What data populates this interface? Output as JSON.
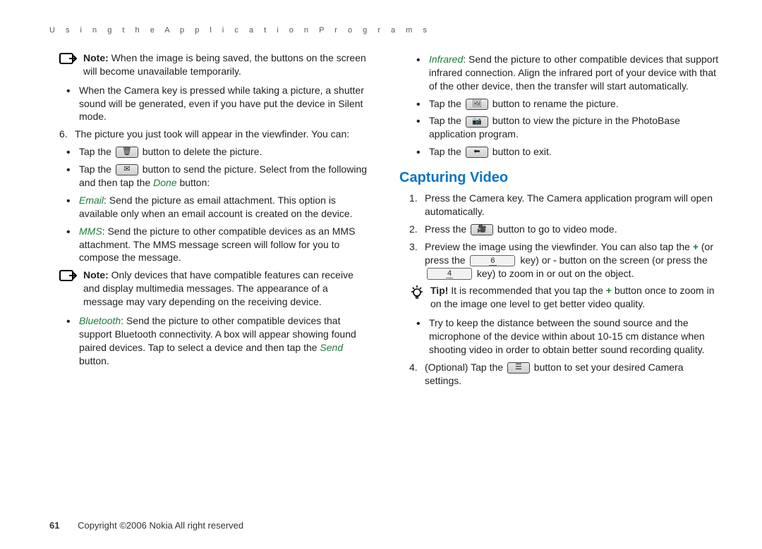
{
  "header": "U s i n g   t h e   A p p l i c a t i o n   P r o g r a m s",
  "left": {
    "note1_label": "Note:",
    "note1_body": " When the image is being saved, the buttons on the screen will become unavailable temporarily.",
    "bullet_silent": "When the Camera key is pressed while taking a picture, a shutter sound will be generated, even if you have put the device in Silent mode.",
    "step6_num": "6.",
    "step6": "The picture you just took will appear in the viewfinder. You can:",
    "b_delete_a": "Tap the ",
    "b_delete_b": " button to delete the picture.",
    "b_send_a": "Tap the ",
    "b_send_b": " button to send the picture. Select from the following and then tap the ",
    "b_send_done": "Done",
    "b_send_c": " button:",
    "email_label": "Email",
    "email_body": ": Send the picture as email attachment. This option is available only when an email account is created on the device.",
    "mms_label": "MMS",
    "mms_body": ": Send the picture to other compatible devices as an MMS attachment. The MMS message screen will follow for you to compose the message.",
    "note2_label": "Note:",
    "note2_body": " Only devices that have compatible features can receive and display multimedia messages. The appearance of a message may vary depending on the receiving device.",
    "bt_label": "Bluetooth",
    "bt_body": ": Send the picture to other compatible devices that support Bluetooth connectivity. A box will appear showing found paired devices. Tap to select a device and then tap the ",
    "bt_send": "Send",
    "bt_tail": " button.",
    "icons": {
      "trash": "🗑",
      "envelope": "✉"
    }
  },
  "right": {
    "ir_label": "Infrared",
    "ir_body": ": Send the picture to other compatible devices that support infrared connection. Align the infrared port of your device with that of the other device, then the transfer will start automatically.",
    "rename_a": "Tap the ",
    "rename_b": " button to rename the picture.",
    "view_a": "Tap the ",
    "view_b": " button to view the picture in the PhotoBase application program.",
    "exit_a": "Tap the ",
    "exit_b": " button to exit.",
    "h2": "Capturing Video",
    "s1_num": "1.",
    "s1": "Press the Camera key. The Camera application program will open automatically.",
    "s2_num": "2.",
    "s2_a": "Press the ",
    "s2_b": " button to go to video mode.",
    "s3_num": "3.",
    "s3_a": "Preview the image using the viewfinder. You can also tap the ",
    "s3_plus": "+",
    "s3_b": " (or press the ",
    "key6": "6",
    "s3_c": " key) or ",
    "s3_minus": "-",
    "s3_d": " button on the screen (or press the ",
    "key4": "4",
    "s3_e": " key) to zoom in or out on the object.",
    "tip_label": "Tip!",
    "tip_body": " It is recommended that you tap the ",
    "tip_plus": "+",
    "tip_tail": " button once to zoom in on the image one level to get better video quality.",
    "dist": "Try to keep the distance between the sound source and the microphone of the device within about 10-15 cm distance when shooting video in order to obtain better sound recording quality.",
    "s4_num": "4.",
    "s4_a": "(Optional) Tap the ",
    "s4_b": " button to set your desired Camera settings.",
    "icons": {
      "pic": "🖼",
      "photo": "📷",
      "back": "⬅",
      "video": "🎥",
      "settings": "☰"
    }
  },
  "footer": {
    "page": "61",
    "copy": "Copyright ©2006 Nokia All right reserved"
  }
}
